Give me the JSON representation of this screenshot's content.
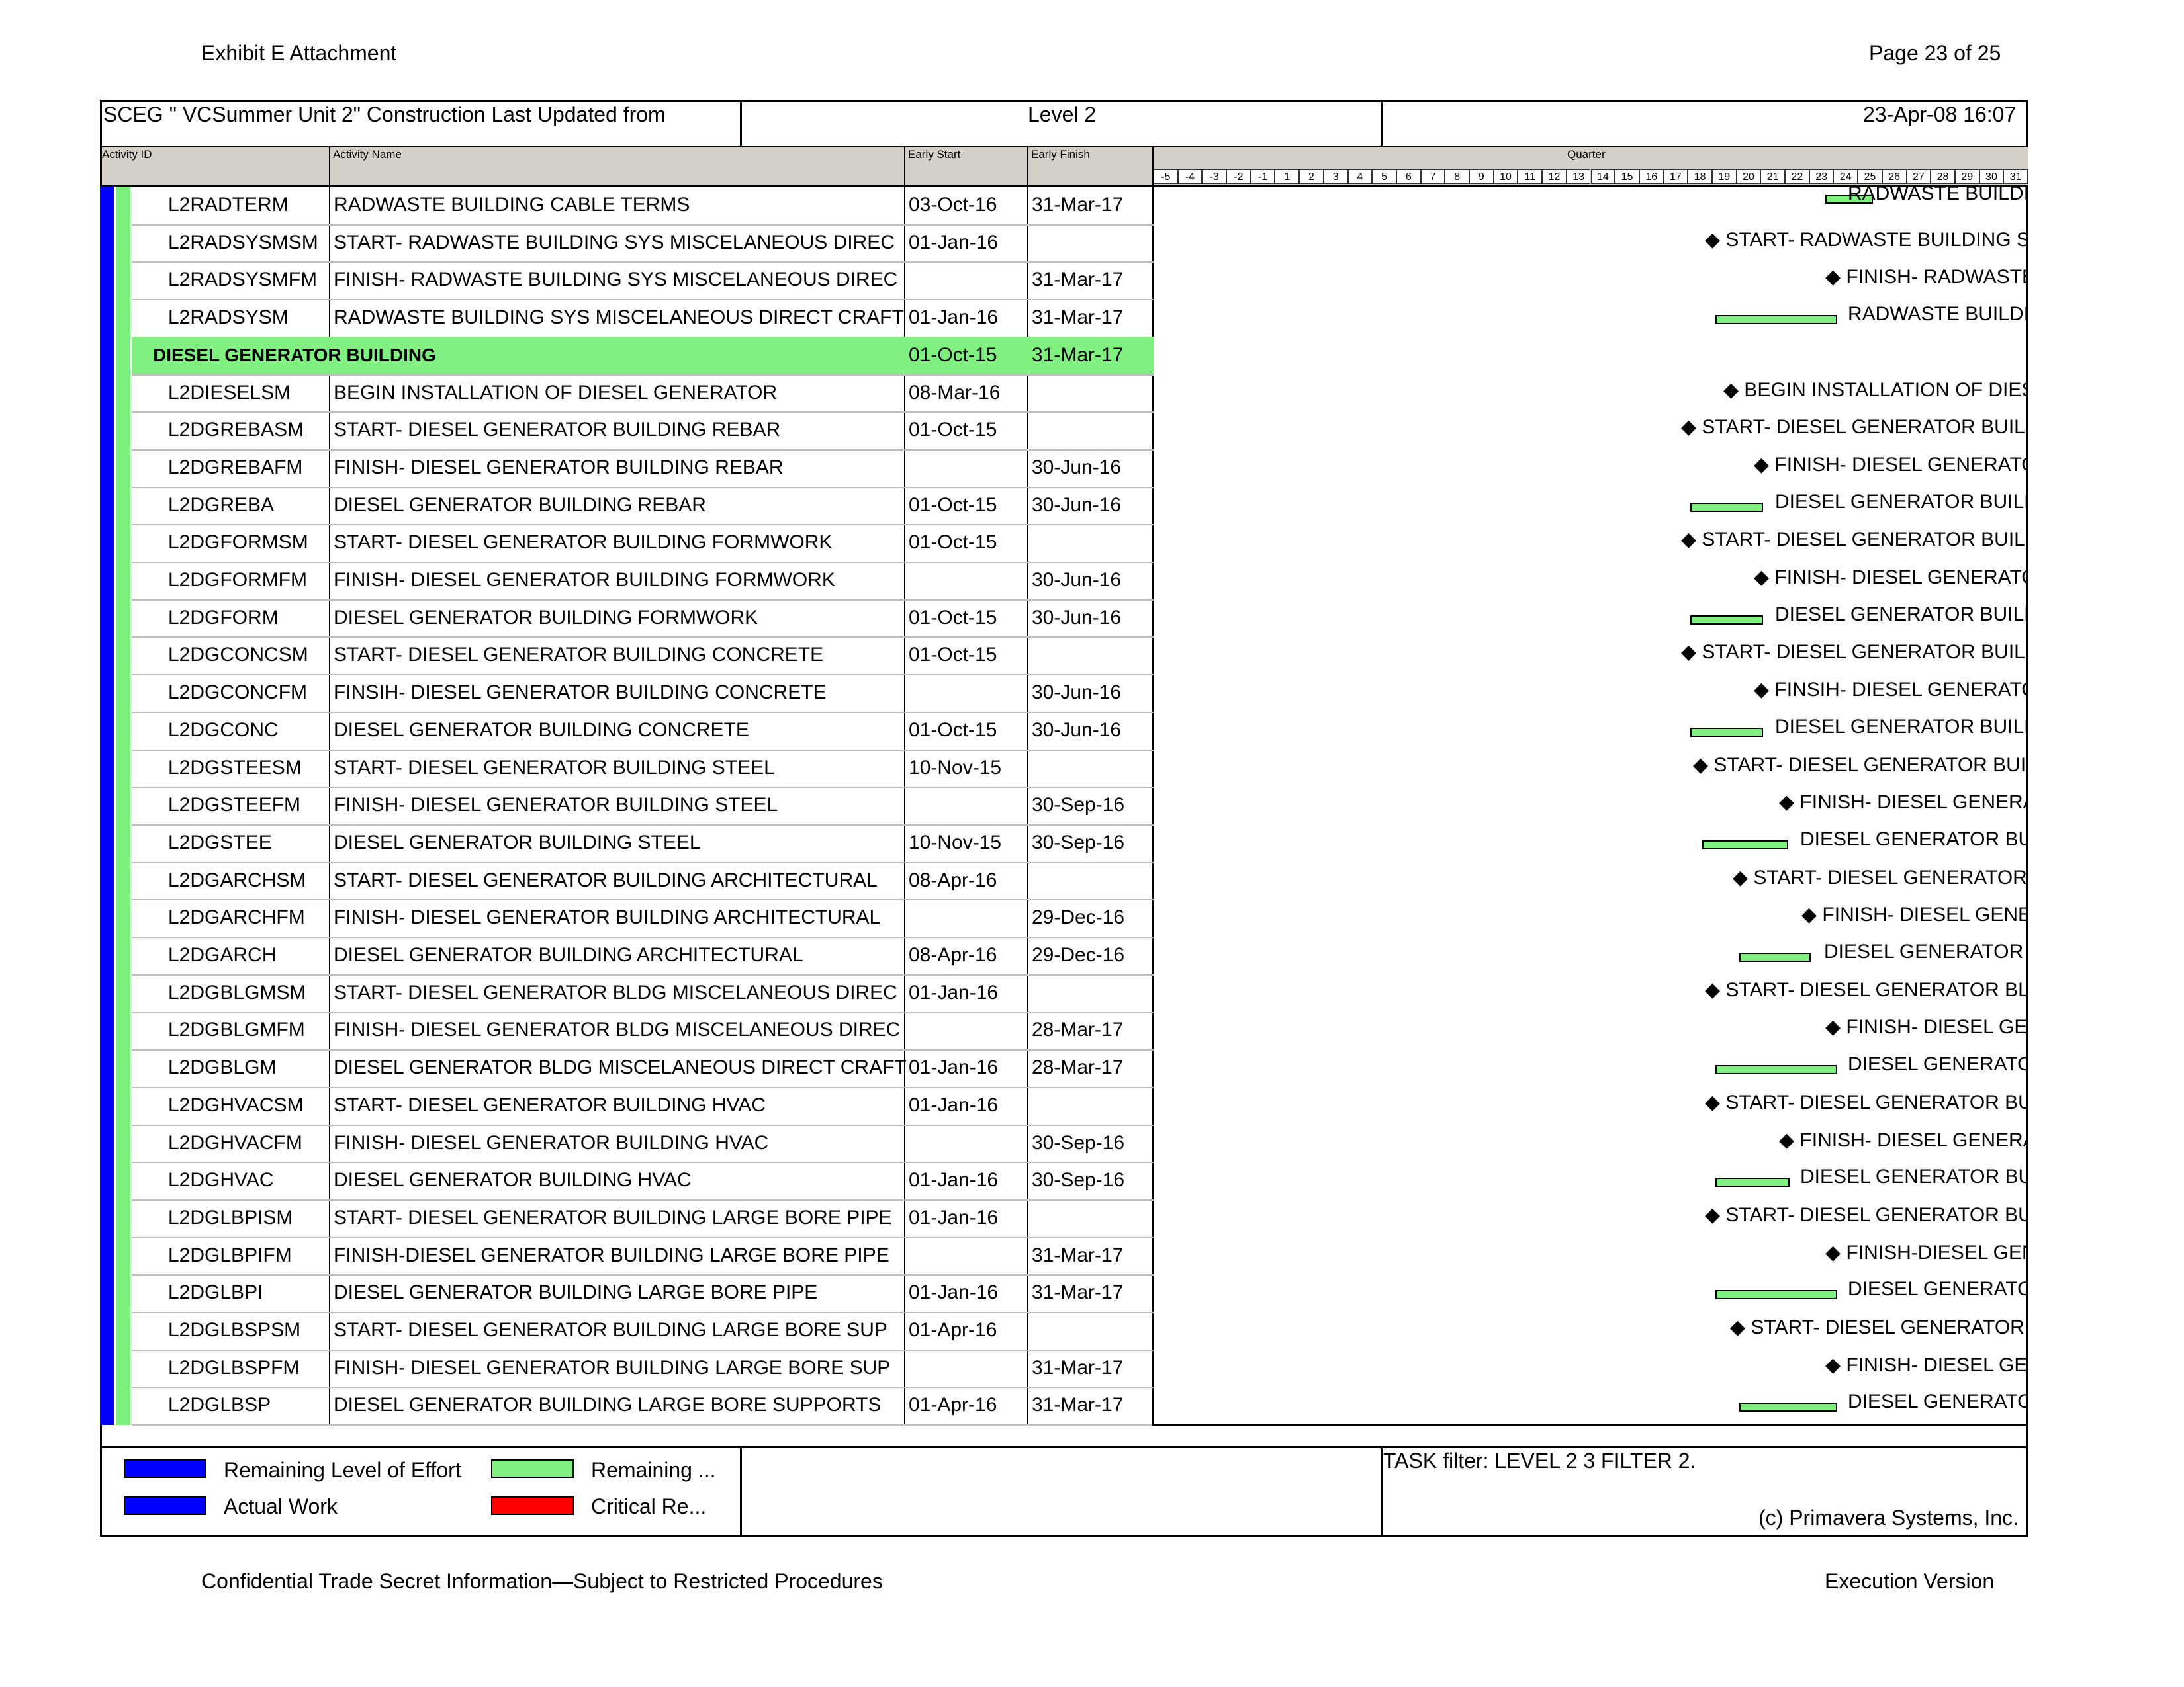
{
  "page": {
    "header_left": "Exhibit E Attachment",
    "header_right": "Page 23 of 25",
    "footer_left": "Confidential Trade Secret Information—Subject to Restricted Procedures",
    "footer_right": "Execution Version"
  },
  "title_bar": {
    "project": "SCEG \" VCSummer Unit 2\" Construction Last Updated from",
    "level": "Level 2",
    "date": "23-Apr-08 16:07"
  },
  "columns": {
    "activity_id": "Activity ID",
    "activity_name": "Activity Name",
    "early_start": "Early Start",
    "early_finish": "Early Finish",
    "gantt": "Quarter"
  },
  "quarter_ticks": [
    "-5",
    "-4",
    "-3",
    "-2",
    "-1",
    "1",
    "2",
    "3",
    "4",
    "5",
    "6",
    "7",
    "8",
    "9",
    "10",
    "11",
    "12",
    "13",
    "14",
    "15",
    "16",
    "17",
    "18",
    "19",
    "20",
    "21",
    "22",
    "23",
    "24",
    "25",
    "26",
    "27",
    "28",
    "29",
    "30",
    "31"
  ],
  "rows": [
    {
      "id": "L2RADTERM",
      "name": "RADWASTE BUILDING CABLE TERMS",
      "start": "03-Oct-16",
      "finish": "31-Mar-17",
      "gantt_label": "RADWASTE BUILDI"
    },
    {
      "id": "L2RADSYSMSM",
      "name": "START- RADWASTE BUILDING SYS MISCELANEOUS DIREC",
      "start": "01-Jan-16",
      "finish": "",
      "gantt_label": "◆ START- RADWASTE BUILDING S"
    },
    {
      "id": "L2RADSYSMFM",
      "name": "FINISH- RADWASTE BUILDING SYS MISCELANEOUS DIREC",
      "start": "",
      "finish": "31-Mar-17",
      "gantt_label": "◆ FINISH- RADWASTE"
    },
    {
      "id": "L2RADSYSM",
      "name": "RADWASTE BUILDING SYS MISCELANEOUS DIRECT CRAFT",
      "start": "01-Jan-16",
      "finish": "31-Mar-17",
      "gantt_label": "RADWASTE BUILDI"
    },
    {
      "id": "DIESEL GENERATOR BUILDING",
      "name": "",
      "start": "01-Oct-15",
      "finish": "31-Mar-17",
      "gantt_label": "",
      "group": true
    },
    {
      "id": "L2DIESELSM",
      "name": "BEGIN INSTALLATION OF DIESEL GENERATOR",
      "start": "08-Mar-16",
      "finish": "",
      "gantt_label": "◆ BEGIN INSTALLATION OF DIES"
    },
    {
      "id": "L2DGREBASM",
      "name": "START- DIESEL GENERATOR BUILDING REBAR",
      "start": "01-Oct-15",
      "finish": "",
      "gantt_label": "◆ START- DIESEL GENERATOR BUILD"
    },
    {
      "id": "L2DGREBAFM",
      "name": "FINISH- DIESEL GENERATOR BUILDING REBAR",
      "start": "",
      "finish": "30-Jun-16",
      "gantt_label": "◆ FINISH- DIESEL GENERATO"
    },
    {
      "id": "L2DGREBA",
      "name": "DIESEL GENERATOR BUILDING REBAR",
      "start": "01-Oct-15",
      "finish": "30-Jun-16",
      "gantt_label": "DIESEL GENERATOR BUILD"
    },
    {
      "id": "L2DGFORMSM",
      "name": "START- DIESEL GENERATOR BUILDING FORMWORK",
      "start": "01-Oct-15",
      "finish": "",
      "gantt_label": "◆ START- DIESEL GENERATOR BUILD"
    },
    {
      "id": "L2DGFORMFM",
      "name": "FINISH- DIESEL GENERATOR BUILDING FORMWORK",
      "start": "",
      "finish": "30-Jun-16",
      "gantt_label": "◆ FINISH- DIESEL GENERATO"
    },
    {
      "id": "L2DGFORM",
      "name": "DIESEL GENERATOR BUILDING FORMWORK",
      "start": "01-Oct-15",
      "finish": "30-Jun-16",
      "gantt_label": "DIESEL GENERATOR BUILD"
    },
    {
      "id": "L2DGCONCSM",
      "name": "START- DIESEL GENERATOR BUILDING CONCRETE",
      "start": "01-Oct-15",
      "finish": "",
      "gantt_label": "◆ START- DIESEL GENERATOR BUILD"
    },
    {
      "id": "L2DGCONCFM",
      "name": "FINSIH- DIESEL GENERATOR BUILDING CONCRETE",
      "start": "",
      "finish": "30-Jun-16",
      "gantt_label": "◆ FINSIH- DIESEL GENERATO"
    },
    {
      "id": "L2DGCONC",
      "name": "DIESEL GENERATOR BUILDING CONCRETE",
      "start": "01-Oct-15",
      "finish": "30-Jun-16",
      "gantt_label": "DIESEL GENERATOR BUILD"
    },
    {
      "id": "L2DGSTEESM",
      "name": "START- DIESEL GENERATOR BUILDING STEEL",
      "start": "10-Nov-15",
      "finish": "",
      "gantt_label": "◆ START- DIESEL GENERATOR BUIL"
    },
    {
      "id": "L2DGSTEEFM",
      "name": "FINISH- DIESEL GENERATOR BUILDING STEEL",
      "start": "",
      "finish": "30-Sep-16",
      "gantt_label": "◆ FINISH- DIESEL GENERA"
    },
    {
      "id": "L2DGSTEE",
      "name": "DIESEL GENERATOR BUILDING STEEL",
      "start": "10-Nov-15",
      "finish": "30-Sep-16",
      "gantt_label": "DIESEL GENERATOR BU"
    },
    {
      "id": "L2DGARCHSM",
      "name": "START- DIESEL GENERATOR BUILDING ARCHITECTURAL",
      "start": "08-Apr-16",
      "finish": "",
      "gantt_label": "◆ START- DIESEL GENERATOR"
    },
    {
      "id": "L2DGARCHFM",
      "name": "FINISH- DIESEL GENERATOR BUILDING ARCHITECTURAL",
      "start": "",
      "finish": "29-Dec-16",
      "gantt_label": "◆ FINISH- DIESEL GENE"
    },
    {
      "id": "L2DGARCH",
      "name": "DIESEL GENERATOR BUILDING ARCHITECTURAL",
      "start": "08-Apr-16",
      "finish": "29-Dec-16",
      "gantt_label": "DIESEL GENERATOR"
    },
    {
      "id": "L2DGBLGMSM",
      "name": "START- DIESEL GENERATOR BLDG MISCELANEOUS DIREC",
      "start": "01-Jan-16",
      "finish": "",
      "gantt_label": "◆ START- DIESEL GENERATOR BL"
    },
    {
      "id": "L2DGBLGMFM",
      "name": "FINISH- DIESEL GENERATOR BLDG MISCELANEOUS DIREC",
      "start": "",
      "finish": "28-Mar-17",
      "gantt_label": "◆ FINISH- DIESEL GE"
    },
    {
      "id": "L2DGBLGM",
      "name": "DIESEL GENERATOR BLDG MISCELANEOUS DIRECT CRAFT",
      "start": "01-Jan-16",
      "finish": "28-Mar-17",
      "gantt_label": "DIESEL GENERATO"
    },
    {
      "id": "L2DGHVACSM",
      "name": "START- DIESEL GENERATOR BUILDING HVAC",
      "start": "01-Jan-16",
      "finish": "",
      "gantt_label": "◆ START- DIESEL GENERATOR BU"
    },
    {
      "id": "L2DGHVACFM",
      "name": "FINISH- DIESEL GENERATOR BUILDING HVAC",
      "start": "",
      "finish": "30-Sep-16",
      "gantt_label": "◆ FINISH- DIESEL GENERA"
    },
    {
      "id": "L2DGHVAC",
      "name": "DIESEL GENERATOR BUILDING HVAC",
      "start": "01-Jan-16",
      "finish": "30-Sep-16",
      "gantt_label": "DIESEL GENERATOR BU"
    },
    {
      "id": "L2DGLBPISM",
      "name": "START- DIESEL GENERATOR BUILDING LARGE BORE PIPE",
      "start": "01-Jan-16",
      "finish": "",
      "gantt_label": "◆ START- DIESEL GENERATOR BU"
    },
    {
      "id": "L2DGLBPIFM",
      "name": "FINISH-DIESEL GENERATOR BUILDING LARGE BORE PIPE",
      "start": "",
      "finish": "31-Mar-17",
      "gantt_label": "◆ FINISH-DIESEL GEN"
    },
    {
      "id": "L2DGLBPI",
      "name": "DIESEL GENERATOR BUILDING LARGE BORE PIPE",
      "start": "01-Jan-16",
      "finish": "31-Mar-17",
      "gantt_label": "DIESEL GENERATO"
    },
    {
      "id": "L2DGLBSPSM",
      "name": "START- DIESEL GENERATOR BUILDING LARGE BORE SUP",
      "start": "01-Apr-16",
      "finish": "",
      "gantt_label": "◆ START- DIESEL GENERATOR"
    },
    {
      "id": "L2DGLBSPFM",
      "name": "FINISH- DIESEL GENERATOR BUILDING LARGE BORE SUP",
      "start": "",
      "finish": "31-Mar-17",
      "gantt_label": "◆ FINISH- DIESEL GE"
    },
    {
      "id": "L2DGLBSP",
      "name": "DIESEL GENERATOR BUILDING LARGE BORE SUPPORTS",
      "start": "01-Apr-16",
      "finish": "31-Mar-17",
      "gantt_label": "DIESEL GENERATO"
    }
  ],
  "legend": {
    "items": [
      {
        "label": "Remaining Level of Effort",
        "color": "#0000ff"
      },
      {
        "label": "Actual Work",
        "color": "#0000ff"
      },
      {
        "label": "Remaining ...",
        "color": "#80f080"
      },
      {
        "label": "Critical Re...",
        "color": "#ff0000"
      }
    ],
    "filter": "TASK filter: LEVEL 2 3 FILTER 2.",
    "copyright": "(c) Primavera Systems, Inc."
  },
  "colors": {
    "level_of_effort": "#0000ff",
    "remaining_work": "#80f080",
    "critical": "#ff0000",
    "header_bg": "#d4d0c8"
  }
}
